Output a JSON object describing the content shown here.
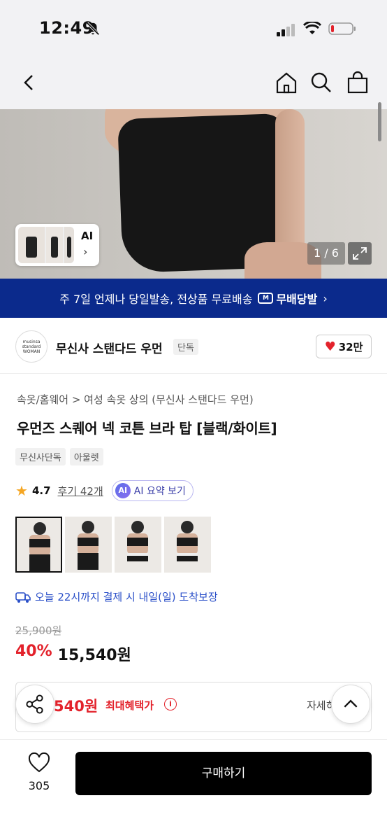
{
  "status_bar": {
    "time": "12:49"
  },
  "gallery": {
    "ai_label": "AI",
    "counter": "1 / 6"
  },
  "banner": {
    "text": "주 7일 언제나 당일발송, 전상품 무료배송",
    "tag": "무배당발",
    "tag_arrow": "›",
    "logo_letter": "M"
  },
  "brand": {
    "logo_text": "musinsa standard WOMAN",
    "name": "무신사 스탠다드 우먼",
    "tag": "단독",
    "likes": "32만"
  },
  "product": {
    "breadcrumb": "속옷/홈웨어 > 여성 속옷 상의 (무신사 스탠다드 우먼)",
    "title": "우먼즈 스퀘어 넥 코튼 브라 탑 [블랙/화이트]",
    "tags": [
      "무신사단독",
      "아울렛"
    ],
    "rating": "4.7",
    "reviews": "후기 42개",
    "ai_badge": "AI",
    "ai_summary": "AI 요약 보기",
    "delivery": "오늘 22시까지 결제 시 내일(일) 도착보장",
    "original_price": "25,900원",
    "discount": "40%",
    "price": "15,540원",
    "benefit_price": "540원",
    "benefit_label": "최대혜택가",
    "benefit_info": "i",
    "detail_link": "자세히"
  },
  "bottom_bar": {
    "wish_count": "305",
    "buy_label": "구매하기"
  }
}
